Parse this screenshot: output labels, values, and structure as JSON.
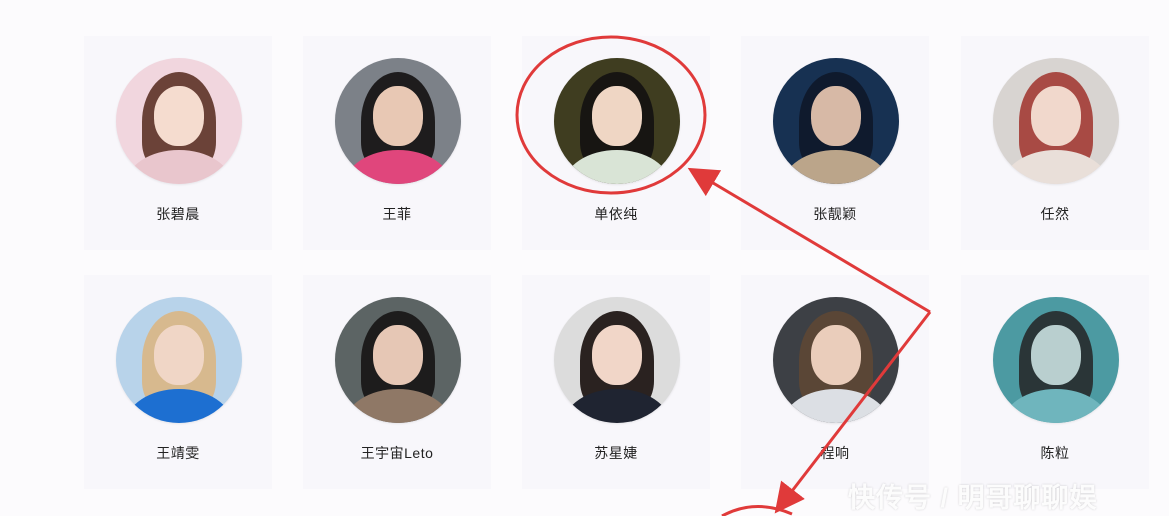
{
  "artists": [
    {
      "name": "张碧晨",
      "bg": "#f1d6de",
      "hair": "#6b4238",
      "skin": "#f5dccf",
      "cloth": "#e9c6cd"
    },
    {
      "name": "王菲",
      "bg": "#7c8188",
      "hair": "#1e1c1d",
      "skin": "#e8c8b4",
      "cloth": "#e0467c"
    },
    {
      "name": "单依纯",
      "bg": "#3f3d20",
      "hair": "#171512",
      "skin": "#efd6c4",
      "cloth": "#d9e4d6"
    },
    {
      "name": "张靓颖",
      "bg": "#173152",
      "hair": "#0f1a2d",
      "skin": "#d7b9a6",
      "cloth": "#bba58a"
    },
    {
      "name": "任然",
      "bg": "#d8d4d1",
      "hair": "#a84a44",
      "skin": "#f1d8cc",
      "cloth": "#e9dfd9"
    },
    {
      "name": "王靖雯",
      "bg": "#b8d3ea",
      "hair": "#d7b98e",
      "skin": "#f0d6c6",
      "cloth": "#1d6fd1"
    },
    {
      "name": "王宇宙Leto",
      "bg": "#5c6464",
      "hair": "#1d1c1c",
      "skin": "#e6c7b5",
      "cloth": "#8f7866"
    },
    {
      "name": "苏星婕",
      "bg": "#dcdcdc",
      "hair": "#2a2220",
      "skin": "#f1d6c8",
      "cloth": "#1f2431"
    },
    {
      "name": "程响",
      "bg": "#3d4045",
      "hair": "#5a4636",
      "skin": "#eacdbb",
      "cloth": "#dcdfe4"
    },
    {
      "name": "陈粒",
      "bg": "#4c9aa2",
      "hair": "#2a3537",
      "skin": "#b9cfcf",
      "cloth": "#6fb5bd"
    }
  ],
  "watermark": "快传号 / 明哥聊聊娱",
  "annotation_color": "#e03a3a"
}
